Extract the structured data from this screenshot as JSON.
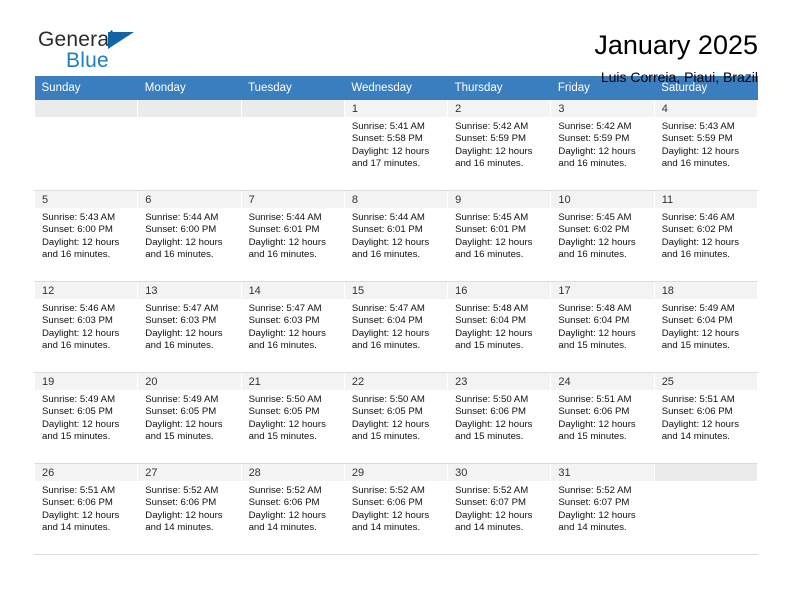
{
  "logo": {
    "word_top": "General",
    "word_bottom": "Blue",
    "triangle_color": "#1464a5",
    "blue_color": "#1d7ec4"
  },
  "header": {
    "title": "January 2025",
    "subtitle": "Luis Correia, Piaui, Brazil"
  },
  "colors": {
    "header_row_bg": "#3a7ebf",
    "header_row_text": "#ffffff",
    "daynum_bg": "#f3f3f3",
    "daynum_bg_shaded": "#ebebeb"
  },
  "weekdays": [
    "Sunday",
    "Monday",
    "Tuesday",
    "Wednesday",
    "Thursday",
    "Friday",
    "Saturday"
  ],
  "labels": {
    "sunrise_prefix": "Sunrise:",
    "sunset_prefix": "Sunset:",
    "daylight_prefix": "Daylight:"
  },
  "weeks": [
    [
      {
        "day": "",
        "sunrise": "",
        "sunset": "",
        "daylight": ""
      },
      {
        "day": "",
        "sunrise": "",
        "sunset": "",
        "daylight": ""
      },
      {
        "day": "",
        "sunrise": "",
        "sunset": "",
        "daylight": ""
      },
      {
        "day": "1",
        "sunrise": "Sunrise: 5:41 AM",
        "sunset": "Sunset: 5:58 PM",
        "daylight": "Daylight: 12 hours and 17 minutes."
      },
      {
        "day": "2",
        "sunrise": "Sunrise: 5:42 AM",
        "sunset": "Sunset: 5:59 PM",
        "daylight": "Daylight: 12 hours and 16 minutes."
      },
      {
        "day": "3",
        "sunrise": "Sunrise: 5:42 AM",
        "sunset": "Sunset: 5:59 PM",
        "daylight": "Daylight: 12 hours and 16 minutes."
      },
      {
        "day": "4",
        "sunrise": "Sunrise: 5:43 AM",
        "sunset": "Sunset: 5:59 PM",
        "daylight": "Daylight: 12 hours and 16 minutes."
      }
    ],
    [
      {
        "day": "5",
        "sunrise": "Sunrise: 5:43 AM",
        "sunset": "Sunset: 6:00 PM",
        "daylight": "Daylight: 12 hours and 16 minutes."
      },
      {
        "day": "6",
        "sunrise": "Sunrise: 5:44 AM",
        "sunset": "Sunset: 6:00 PM",
        "daylight": "Daylight: 12 hours and 16 minutes."
      },
      {
        "day": "7",
        "sunrise": "Sunrise: 5:44 AM",
        "sunset": "Sunset: 6:01 PM",
        "daylight": "Daylight: 12 hours and 16 minutes."
      },
      {
        "day": "8",
        "sunrise": "Sunrise: 5:44 AM",
        "sunset": "Sunset: 6:01 PM",
        "daylight": "Daylight: 12 hours and 16 minutes."
      },
      {
        "day": "9",
        "sunrise": "Sunrise: 5:45 AM",
        "sunset": "Sunset: 6:01 PM",
        "daylight": "Daylight: 12 hours and 16 minutes."
      },
      {
        "day": "10",
        "sunrise": "Sunrise: 5:45 AM",
        "sunset": "Sunset: 6:02 PM",
        "daylight": "Daylight: 12 hours and 16 minutes."
      },
      {
        "day": "11",
        "sunrise": "Sunrise: 5:46 AM",
        "sunset": "Sunset: 6:02 PM",
        "daylight": "Daylight: 12 hours and 16 minutes."
      }
    ],
    [
      {
        "day": "12",
        "sunrise": "Sunrise: 5:46 AM",
        "sunset": "Sunset: 6:03 PM",
        "daylight": "Daylight: 12 hours and 16 minutes."
      },
      {
        "day": "13",
        "sunrise": "Sunrise: 5:47 AM",
        "sunset": "Sunset: 6:03 PM",
        "daylight": "Daylight: 12 hours and 16 minutes."
      },
      {
        "day": "14",
        "sunrise": "Sunrise: 5:47 AM",
        "sunset": "Sunset: 6:03 PM",
        "daylight": "Daylight: 12 hours and 16 minutes."
      },
      {
        "day": "15",
        "sunrise": "Sunrise: 5:47 AM",
        "sunset": "Sunset: 6:04 PM",
        "daylight": "Daylight: 12 hours and 16 minutes."
      },
      {
        "day": "16",
        "sunrise": "Sunrise: 5:48 AM",
        "sunset": "Sunset: 6:04 PM",
        "daylight": "Daylight: 12 hours and 15 minutes."
      },
      {
        "day": "17",
        "sunrise": "Sunrise: 5:48 AM",
        "sunset": "Sunset: 6:04 PM",
        "daylight": "Daylight: 12 hours and 15 minutes."
      },
      {
        "day": "18",
        "sunrise": "Sunrise: 5:49 AM",
        "sunset": "Sunset: 6:04 PM",
        "daylight": "Daylight: 12 hours and 15 minutes."
      }
    ],
    [
      {
        "day": "19",
        "sunrise": "Sunrise: 5:49 AM",
        "sunset": "Sunset: 6:05 PM",
        "daylight": "Daylight: 12 hours and 15 minutes."
      },
      {
        "day": "20",
        "sunrise": "Sunrise: 5:49 AM",
        "sunset": "Sunset: 6:05 PM",
        "daylight": "Daylight: 12 hours and 15 minutes."
      },
      {
        "day": "21",
        "sunrise": "Sunrise: 5:50 AM",
        "sunset": "Sunset: 6:05 PM",
        "daylight": "Daylight: 12 hours and 15 minutes."
      },
      {
        "day": "22",
        "sunrise": "Sunrise: 5:50 AM",
        "sunset": "Sunset: 6:05 PM",
        "daylight": "Daylight: 12 hours and 15 minutes."
      },
      {
        "day": "23",
        "sunrise": "Sunrise: 5:50 AM",
        "sunset": "Sunset: 6:06 PM",
        "daylight": "Daylight: 12 hours and 15 minutes."
      },
      {
        "day": "24",
        "sunrise": "Sunrise: 5:51 AM",
        "sunset": "Sunset: 6:06 PM",
        "daylight": "Daylight: 12 hours and 15 minutes."
      },
      {
        "day": "25",
        "sunrise": "Sunrise: 5:51 AM",
        "sunset": "Sunset: 6:06 PM",
        "daylight": "Daylight: 12 hours and 14 minutes."
      }
    ],
    [
      {
        "day": "26",
        "sunrise": "Sunrise: 5:51 AM",
        "sunset": "Sunset: 6:06 PM",
        "daylight": "Daylight: 12 hours and 14 minutes."
      },
      {
        "day": "27",
        "sunrise": "Sunrise: 5:52 AM",
        "sunset": "Sunset: 6:06 PM",
        "daylight": "Daylight: 12 hours and 14 minutes."
      },
      {
        "day": "28",
        "sunrise": "Sunrise: 5:52 AM",
        "sunset": "Sunset: 6:06 PM",
        "daylight": "Daylight: 12 hours and 14 minutes."
      },
      {
        "day": "29",
        "sunrise": "Sunrise: 5:52 AM",
        "sunset": "Sunset: 6:06 PM",
        "daylight": "Daylight: 12 hours and 14 minutes."
      },
      {
        "day": "30",
        "sunrise": "Sunrise: 5:52 AM",
        "sunset": "Sunset: 6:07 PM",
        "daylight": "Daylight: 12 hours and 14 minutes."
      },
      {
        "day": "31",
        "sunrise": "Sunrise: 5:52 AM",
        "sunset": "Sunset: 6:07 PM",
        "daylight": "Daylight: 12 hours and 14 minutes."
      },
      {
        "day": "",
        "sunrise": "",
        "sunset": "",
        "daylight": ""
      }
    ]
  ]
}
